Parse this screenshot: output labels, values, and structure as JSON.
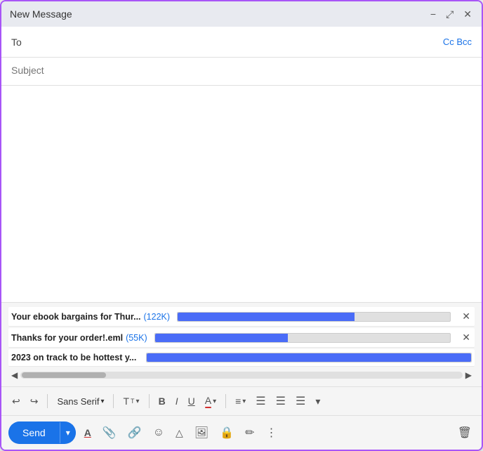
{
  "window": {
    "title": "New Message",
    "minimize": "−",
    "expand": "⤢",
    "close": "✕"
  },
  "header": {
    "to_label": "To",
    "cc_bcc": "Cc Bcc"
  },
  "subject": {
    "placeholder": "Subject",
    "value": ""
  },
  "attachments": [
    {
      "name": "Your ebook bargains for Thur...",
      "size": "(122K)",
      "progress": 65,
      "has_close": true
    },
    {
      "name": "Thanks for your order!.eml",
      "size": "(55K)",
      "progress": 45,
      "has_close": true
    },
    {
      "name": "2023 on track to be hottest y...",
      "size": "",
      "progress": 100,
      "has_close": false
    }
  ],
  "toolbar": {
    "undo": "↩",
    "redo": "↪",
    "font_name": "Sans Serif",
    "font_size_icon": "Tᴛ",
    "bold": "B",
    "italic": "I",
    "underline": "U",
    "font_color": "A",
    "align": "≡",
    "ordered_list": "☰",
    "unordered_list": "☰",
    "indent": "☰",
    "more": "▾"
  },
  "bottom": {
    "send_label": "Send",
    "send_arrow": "▾",
    "format_icon": "A",
    "attachment_icon": "📎",
    "link_icon": "🔗",
    "emoji_icon": "☺",
    "drive_icon": "△",
    "photo_icon": "🖼",
    "lock_icon": "🔒",
    "signature_icon": "✏",
    "more_icon": "⋮",
    "trash_icon": "🗑"
  }
}
